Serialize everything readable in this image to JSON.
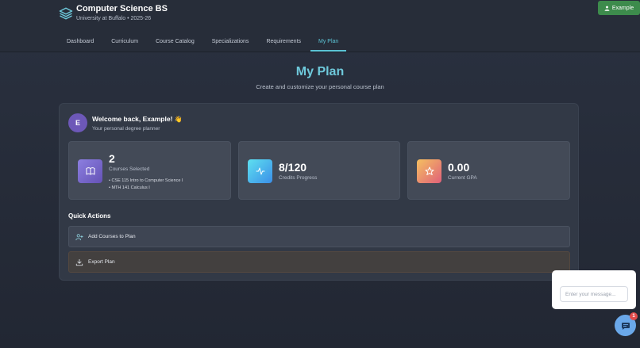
{
  "header": {
    "title": "Computer Science BS",
    "subtitle": "University at Buffalo • 2025-26",
    "user_button": "Example"
  },
  "nav": {
    "tabs": [
      {
        "label": "Dashboard",
        "active": false
      },
      {
        "label": "Curriculum",
        "active": false
      },
      {
        "label": "Course Catalog",
        "active": false
      },
      {
        "label": "Specializations",
        "active": false
      },
      {
        "label": "Requirements",
        "active": false
      },
      {
        "label": "My Plan",
        "active": true
      }
    ]
  },
  "page": {
    "title": "My Plan",
    "subtitle": "Create and customize your personal course plan"
  },
  "welcome": {
    "avatar_letter": "E",
    "title": "Welcome back, Example!",
    "emoji": "👋",
    "subtitle": "Your personal degree planner"
  },
  "stats": {
    "courses": {
      "value": "2",
      "label": "Courses Selected",
      "items": [
        "• CSE 115 Intro to Computer Science I",
        "• MTH 141 Calculus I"
      ],
      "icon": "book-icon"
    },
    "credits": {
      "value": "8/120",
      "label": "Credits Progress",
      "icon": "activity-icon"
    },
    "gpa": {
      "value": "0.00",
      "label": "Current GPA",
      "icon": "star-icon"
    }
  },
  "quick_actions": {
    "title": "Quick Actions",
    "add_label": "Add Courses to Plan",
    "export_label": "Export Plan"
  },
  "chat": {
    "placeholder": "Enter your message...",
    "badge_count": "1"
  },
  "colors": {
    "accent": "#5bc3d4",
    "user_button": "#3d8b4c",
    "avatar": "#6d58b8",
    "chat_fab": "#6aa8ea",
    "badge": "#e14b4b"
  }
}
